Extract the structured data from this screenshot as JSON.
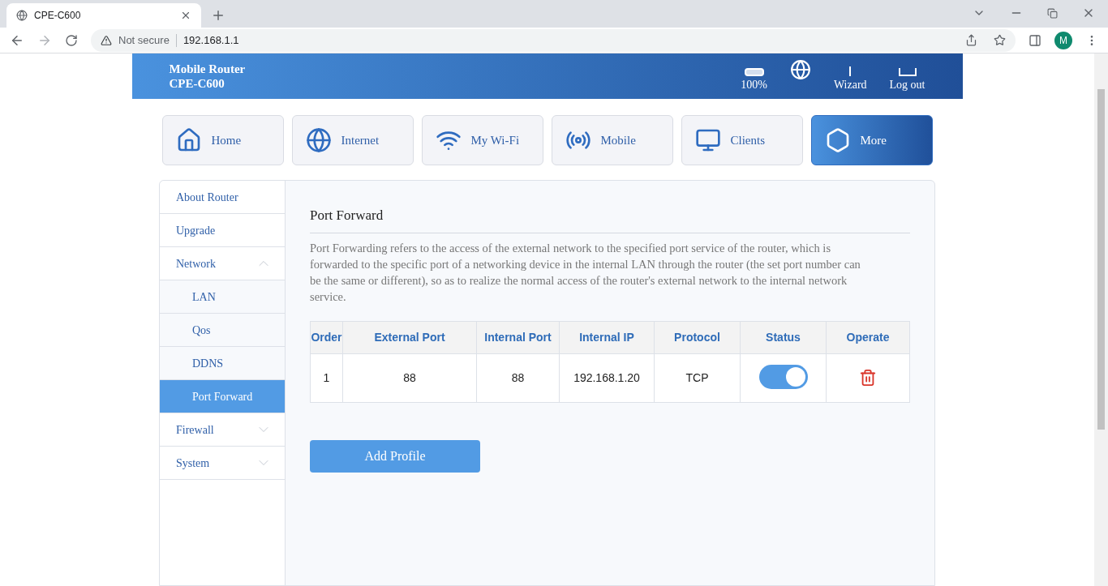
{
  "browser": {
    "tab_title": "CPE-C600",
    "security": "Not secure",
    "url": "192.168.1.1",
    "profile_initial": "M"
  },
  "header": {
    "brand_line1": "Mobile Router",
    "brand_line2": "CPE-C600",
    "battery": "100%",
    "wizard": "Wizard",
    "logout": "Log out"
  },
  "nav": [
    {
      "label": "Home",
      "kind": "home",
      "selected": false
    },
    {
      "label": "Internet",
      "kind": "internet",
      "selected": false
    },
    {
      "label": "My Wi-Fi",
      "kind": "wifi",
      "selected": false
    },
    {
      "label": "Mobile",
      "kind": "mobile",
      "selected": false
    },
    {
      "label": "Clients",
      "kind": "clients",
      "selected": false
    },
    {
      "label": "More",
      "kind": "more",
      "selected": true
    }
  ],
  "sidebar": [
    {
      "label": "About Router",
      "selected": false
    },
    {
      "label": "Upgrade",
      "selected": false
    },
    {
      "label": "Network",
      "selected": false,
      "expanded": true,
      "children": [
        {
          "label": "LAN",
          "selected": false
        },
        {
          "label": "Qos",
          "selected": false
        },
        {
          "label": "DDNS",
          "selected": false
        },
        {
          "label": "Port Forward",
          "selected": true
        }
      ]
    },
    {
      "label": "Firewall",
      "selected": false,
      "expanded": false
    },
    {
      "label": "System",
      "selected": false,
      "expanded": false
    }
  ],
  "content": {
    "title": "Port Forward",
    "description": "Port Forwarding refers to the access of the external network to the specified port service of the router, which is forwarded to the specific port of a networking device in the internal LAN through the router (the set port number can be the same or different), so as to realize the normal access of the router's external network to the internal network service.",
    "table": {
      "columns": [
        "Order",
        "External Port",
        "Internal Port",
        "Internal IP",
        "Protocol",
        "Status",
        "Operate"
      ],
      "rows": [
        {
          "order": "1",
          "external_port": "88",
          "internal_port": "88",
          "internal_ip": "192.168.1.20",
          "protocol": "TCP",
          "on": true
        }
      ]
    },
    "add_button": "Add Profile"
  }
}
